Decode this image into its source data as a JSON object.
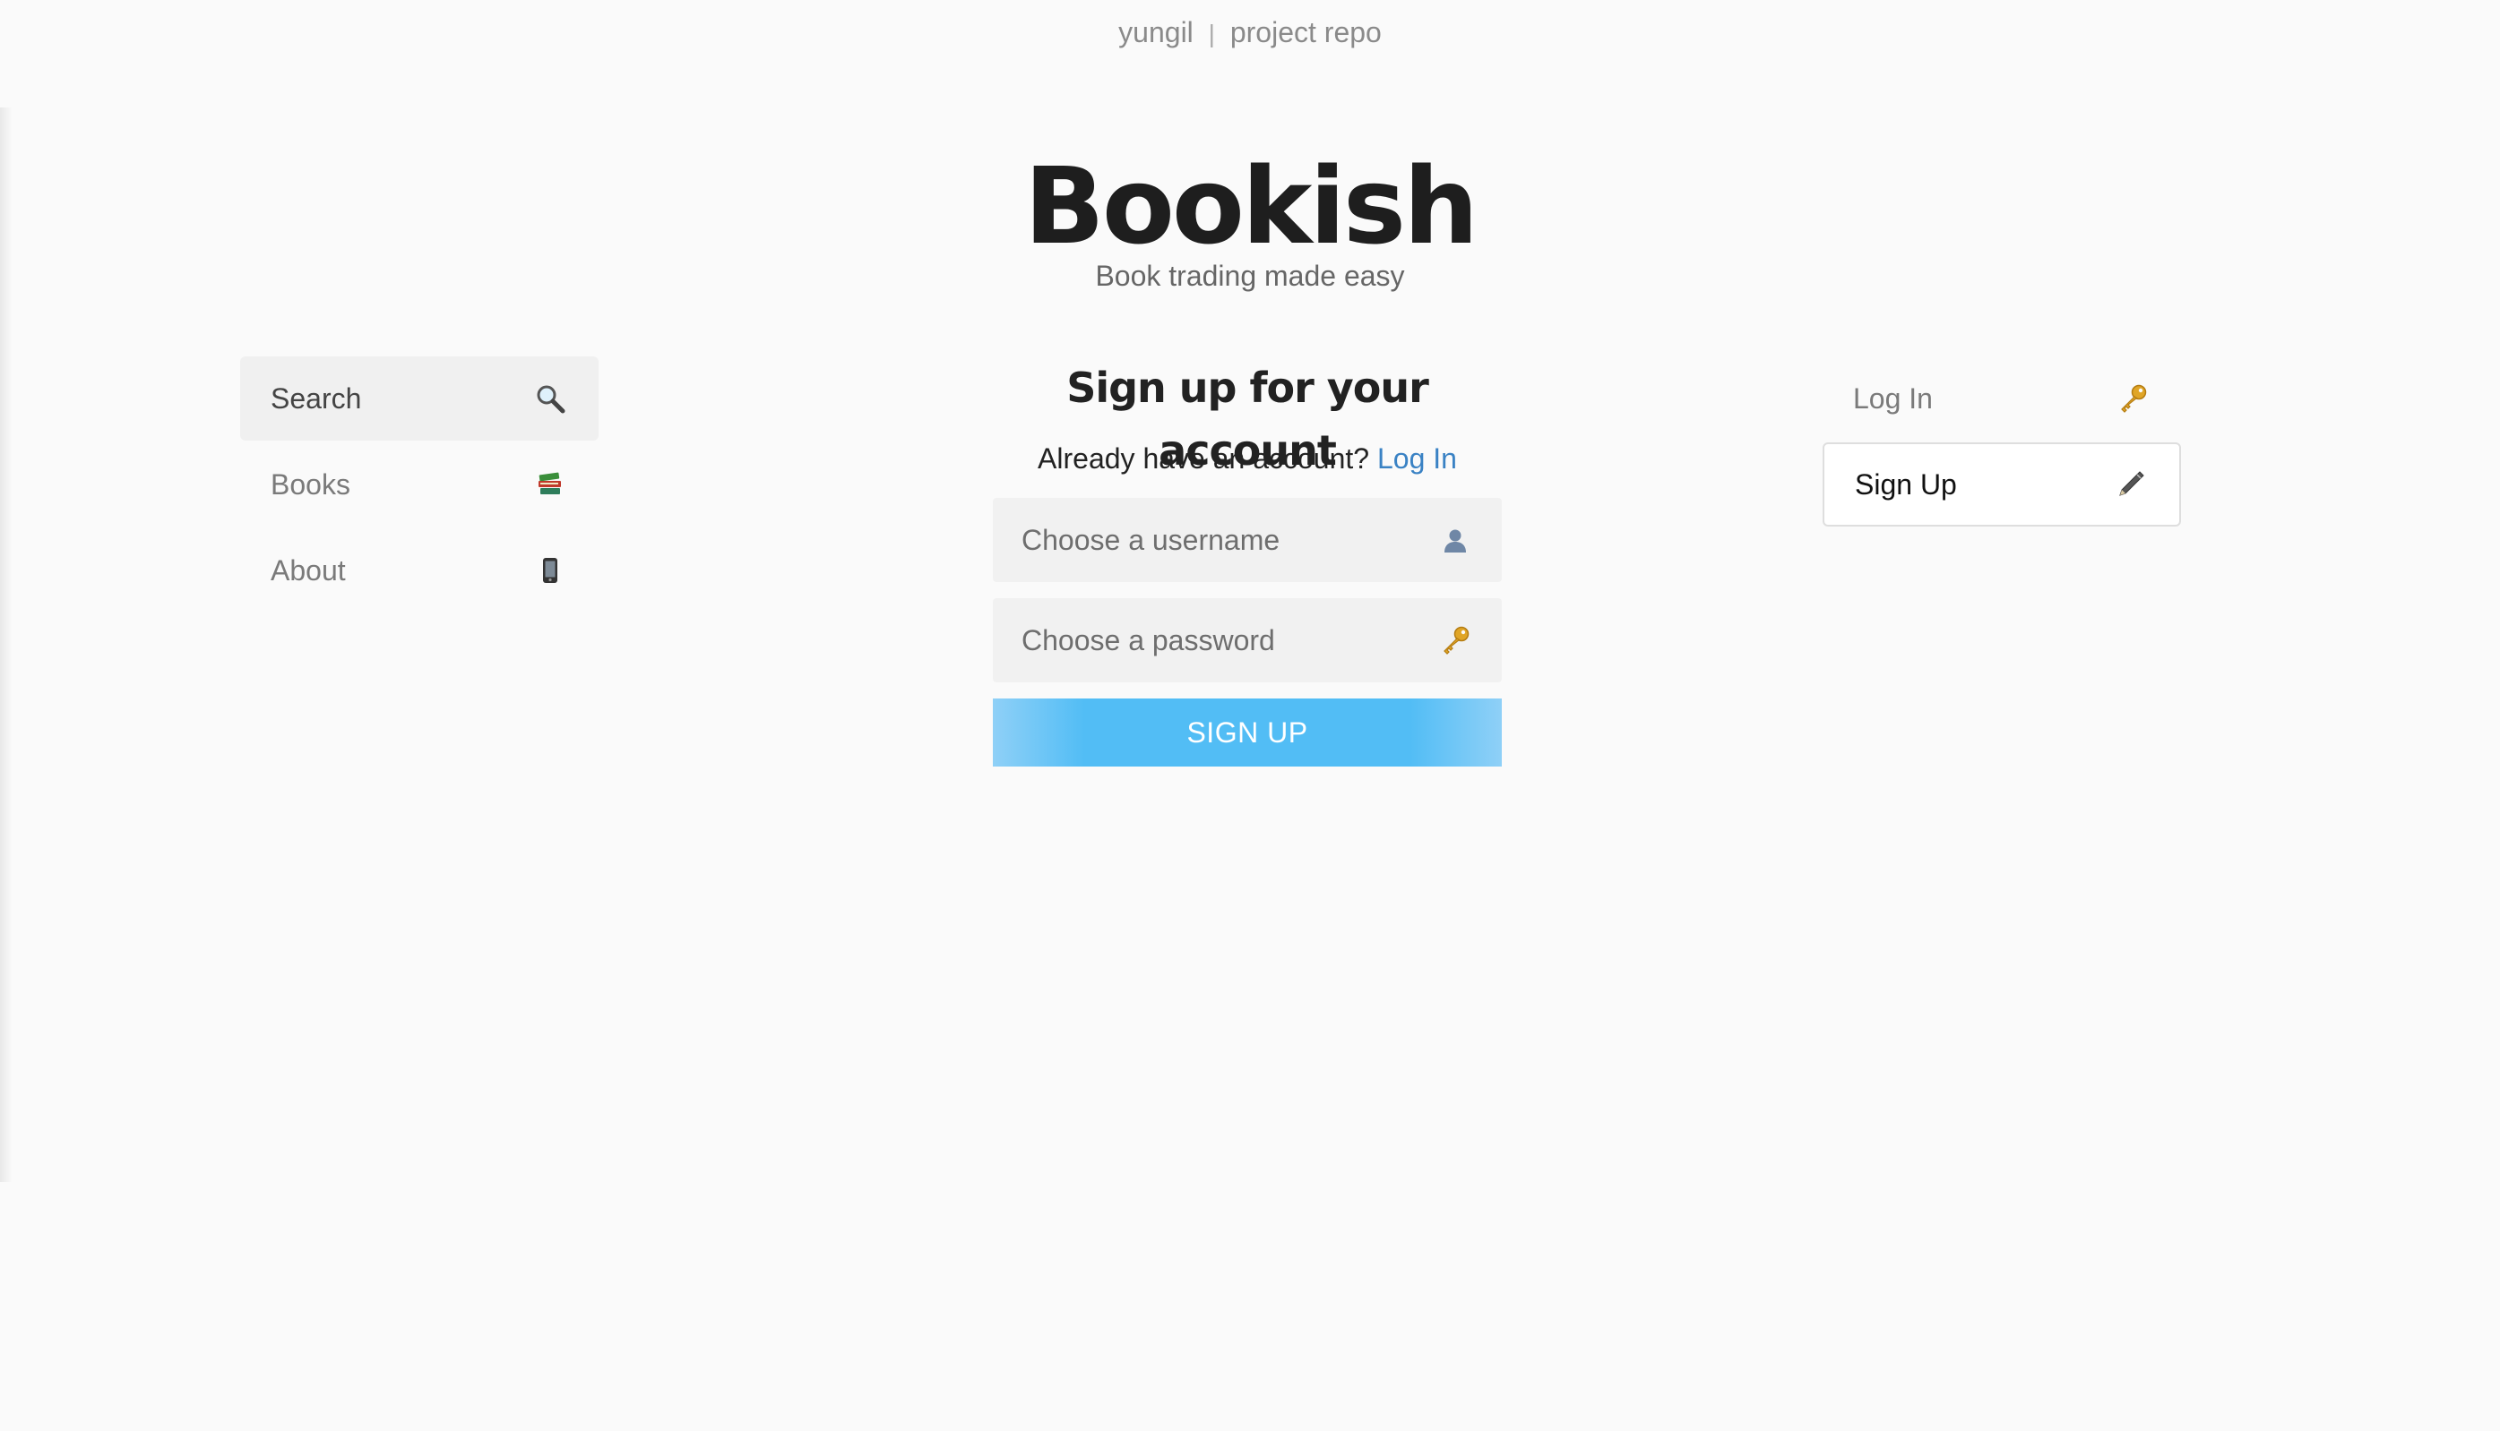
{
  "header": {
    "user": "yungil",
    "separator": "|",
    "project": "project repo"
  },
  "brand": {
    "title": "Bookish",
    "tagline": "Book trading made easy"
  },
  "left_menu": {
    "items": [
      {
        "label": "Search",
        "icon": "magnifier-icon"
      },
      {
        "label": "Books",
        "icon": "books-icon"
      },
      {
        "label": "About",
        "icon": "phone-icon"
      }
    ]
  },
  "right_menu": {
    "items": [
      {
        "label": "Log In",
        "icon": "key-icon"
      },
      {
        "label": "Sign Up",
        "icon": "pen-icon"
      }
    ]
  },
  "form": {
    "title": "Sign up for your account",
    "prompt": "Already have an account?",
    "login_link": "Log In",
    "username_placeholder": "Choose a username",
    "username_value": "",
    "password_placeholder": "Choose a password",
    "password_value": "",
    "submit_label": "SIGN UP"
  },
  "colors": {
    "background": "#fafafa",
    "accent": "#52bdf5",
    "link": "#3a82c4"
  }
}
